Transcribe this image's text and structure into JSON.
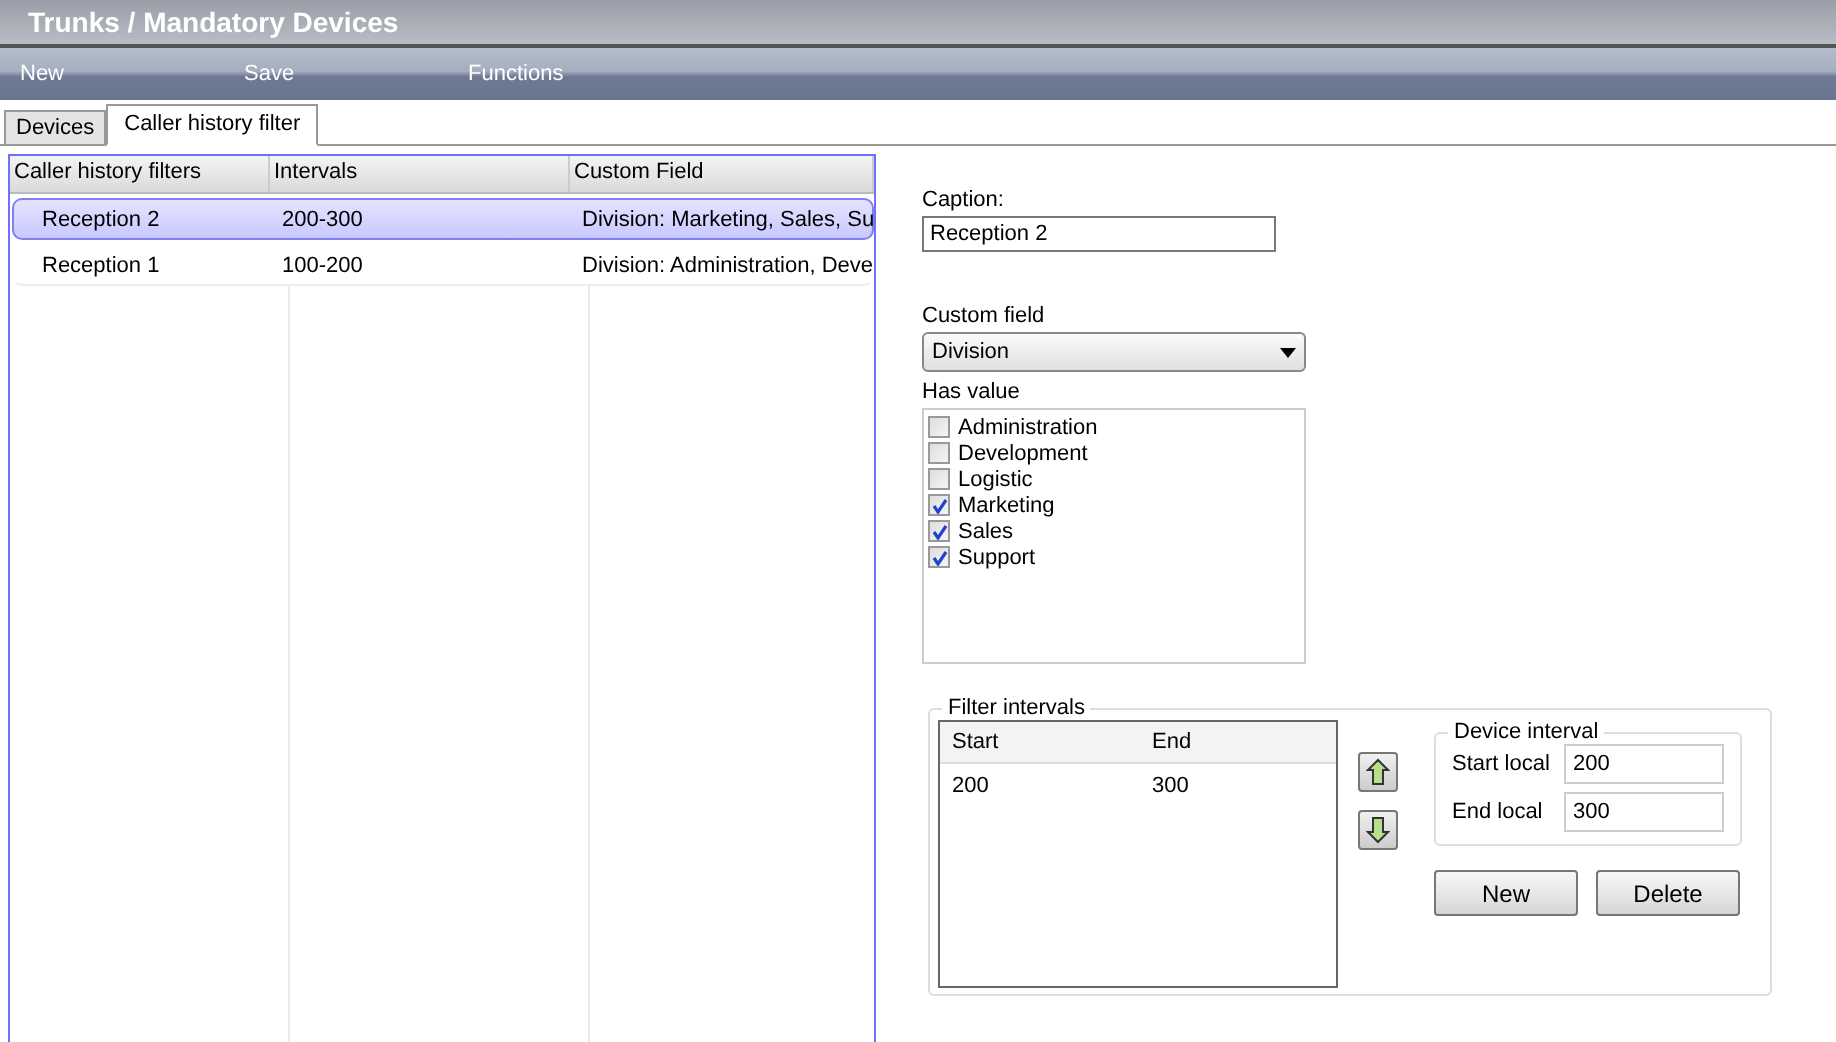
{
  "window": {
    "title": "Trunks / Mandatory Devices"
  },
  "toolbar": [
    "New",
    "Save",
    "Functions"
  ],
  "tabs": [
    {
      "label": "Devices",
      "selected": false
    },
    {
      "label": "Caller history filter",
      "selected": true
    }
  ],
  "grid": {
    "columns": [
      "Caller history filters",
      "Intervals",
      "Custom Field"
    ],
    "rows": [
      {
        "cells": [
          "Reception 2",
          "200-300",
          "Division: Marketing, Sales, Su"
        ],
        "selected": true
      },
      {
        "cells": [
          "Reception 1",
          "100-200",
          "Division: Administration, Deve"
        ],
        "selected": false
      }
    ]
  },
  "caption": {
    "label": "Caption:",
    "value": "Reception 2"
  },
  "custom_field": {
    "label": "Custom field",
    "value": "Division"
  },
  "has_value": {
    "label": "Has value",
    "items": [
      {
        "label": "Administration",
        "checked": false
      },
      {
        "label": "Development",
        "checked": false
      },
      {
        "label": "Logistic",
        "checked": false
      },
      {
        "label": "Marketing",
        "checked": true
      },
      {
        "label": "Sales",
        "checked": true
      },
      {
        "label": "Support",
        "checked": true
      }
    ]
  },
  "filter_intervals": {
    "title": "Filter intervals",
    "columns": [
      "Start",
      "End"
    ],
    "rows": [
      [
        "200",
        "300"
      ]
    ],
    "device_interval": {
      "title": "Device interval",
      "start_label": "Start local",
      "start_value": "200",
      "end_label": "End local",
      "end_value": "300"
    },
    "buttons": [
      "New",
      "Delete"
    ]
  }
}
